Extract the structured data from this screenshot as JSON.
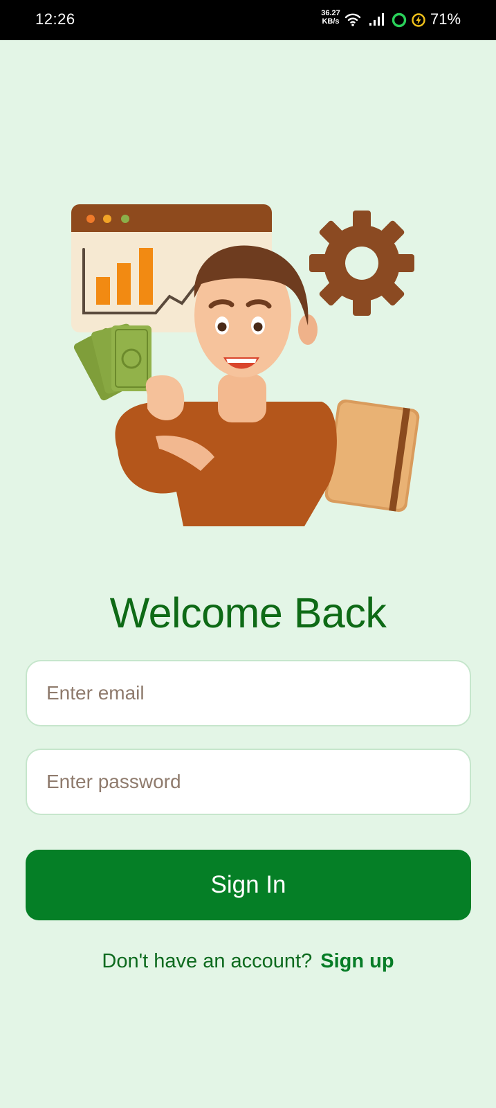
{
  "status_bar": {
    "time": "12:26",
    "net_speed_value": "36.27",
    "net_speed_unit": "KB/s",
    "battery": "71%",
    "icons": [
      "wifi-icon",
      "signal-icon",
      "ring-icon",
      "battery-saver-icon"
    ]
  },
  "hero": {
    "icon": "finance-illustration"
  },
  "login": {
    "title": "Welcome Back",
    "email_placeholder": "Enter email",
    "email_value": "",
    "password_placeholder": "Enter password",
    "password_value": "",
    "signin_label": "Sign In",
    "signup_prompt": "Don't have an account?",
    "signup_link": "Sign up"
  },
  "colors": {
    "background": "#e3f5e6",
    "primary": "#057f26",
    "title": "#0e6a16",
    "placeholder": "#8f7b6d"
  }
}
